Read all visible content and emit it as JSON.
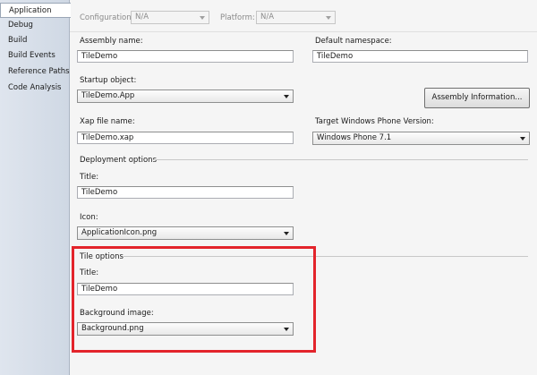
{
  "sidebar": {
    "tabs": [
      {
        "label": "Application",
        "active": true
      },
      {
        "label": "Debug"
      },
      {
        "label": "Build"
      },
      {
        "label": "Build Events"
      },
      {
        "label": "Reference Paths"
      },
      {
        "label": "Code Analysis"
      }
    ]
  },
  "top": {
    "configuration_label": "Configuration:",
    "configuration_value": "N/A",
    "platform_label": "Platform:",
    "platform_value": "N/A"
  },
  "assembly": {
    "name_label": "Assembly name:",
    "name_value": "TileDemo",
    "namespace_label": "Default namespace:",
    "namespace_value": "TileDemo"
  },
  "startup": {
    "label": "Startup object:",
    "value": "TileDemo.App",
    "assembly_info_button": "Assembly Information..."
  },
  "xap": {
    "label": "Xap file name:",
    "value": "TileDemo.xap",
    "target_label": "Target Windows Phone Version:",
    "target_value": "Windows Phone 7.1"
  },
  "deployment": {
    "group_label": "Deployment options",
    "title_label": "Title:",
    "title_value": "TileDemo",
    "icon_label": "Icon:",
    "icon_value": "ApplicationIcon.png"
  },
  "tile": {
    "group_label": "Tile options",
    "title_label": "Title:",
    "title_value": "TileDemo",
    "background_label": "Background image:",
    "background_value": "Background.png"
  },
  "colors": {
    "highlight": "#e3242b"
  }
}
